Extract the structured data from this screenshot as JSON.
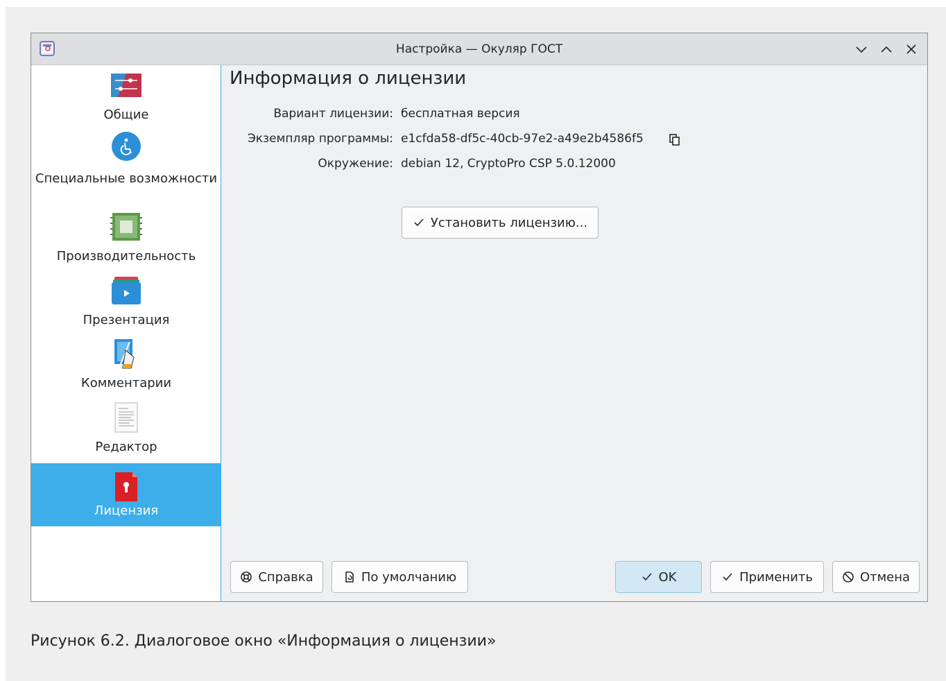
{
  "window": {
    "title": "Настройка — Окуляр ГОСТ"
  },
  "sidebar": {
    "items": [
      {
        "label": "Общие",
        "icon": "general-settings-icon"
      },
      {
        "label": "Специальные возможности",
        "icon": "accessibility-icon"
      },
      {
        "label": "Производительность",
        "icon": "performance-chip-icon"
      },
      {
        "label": "Презентация",
        "icon": "presentation-icon"
      },
      {
        "label": "Комментарии",
        "icon": "annotations-pen-icon"
      },
      {
        "label": "Редактор",
        "icon": "editor-document-icon"
      },
      {
        "label": "Лицензия",
        "icon": "license-keyhole-icon",
        "active": true
      }
    ]
  },
  "license": {
    "heading": "Информация о лицензии",
    "variant_label": "Вариант лицензии:",
    "variant_value": "бесплатная версия",
    "instance_label": "Экземпляр программы:",
    "instance_value": "e1cfda58-df5c-40cb-97e2-a49e2b4586f5",
    "environment_label": "Окружение:",
    "environment_value": "debian 12, CryptoPro CSP 5.0.12000",
    "install_button": "Установить лицензию..."
  },
  "buttons": {
    "help": "Справка",
    "defaults": "По умолчанию",
    "ok": "OK",
    "apply": "Применить",
    "cancel": "Отмена"
  },
  "caption": "Рисунок 6.2. Диалоговое окно «Информация о лицензии»",
  "colors": {
    "accent": "#3daee9",
    "license_icon": "#da1f26"
  }
}
